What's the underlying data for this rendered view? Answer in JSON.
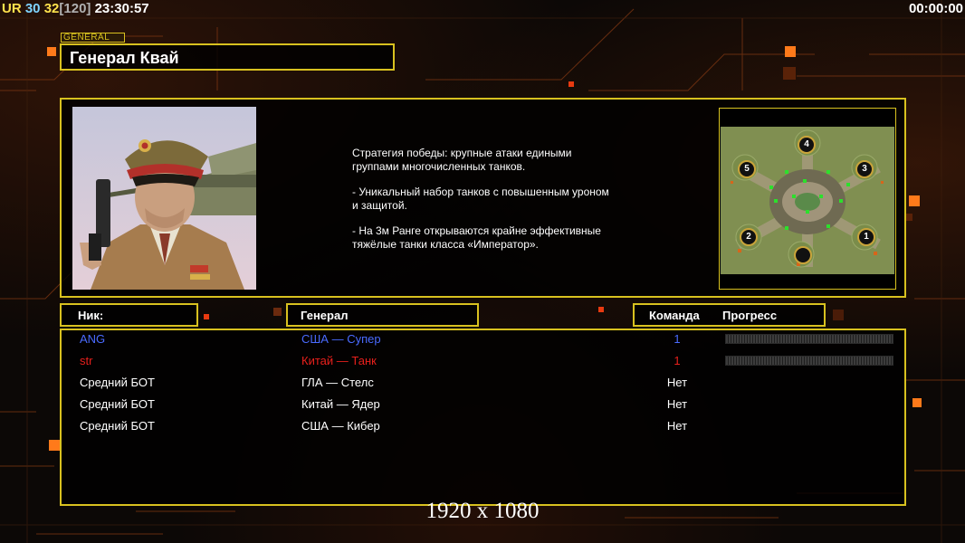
{
  "hud": {
    "ur_label": "UR",
    "fps_a": "30",
    "fps_b": "32",
    "fps_cap": "[120]",
    "clock": "23:30:57",
    "game_timer": "00:00:00"
  },
  "general_tag": "GENERAL",
  "general_name": "Генерал Квай",
  "description": [
    "Стратегия победы: крупные атаки едиными\n группами многочисленных танков.",
    "- Уникальный набор танков с повышенным уроном\n и защитой.",
    "- На 3м Ранге открываются крайне эффективные\n тяжёлые танки класса «Император»."
  ],
  "map": {
    "start_markers": [
      "4",
      "5",
      "3",
      "2",
      "1"
    ]
  },
  "columns": {
    "nick": "Ник:",
    "general": "Генерал",
    "team": "Команда",
    "progress": "Прогресс"
  },
  "players": [
    {
      "nick": "ANG",
      "general": "США — Супер",
      "team": "1",
      "color": "#4a6bff",
      "progress_bar": true
    },
    {
      "nick": "str",
      "general": "Китай — Танк",
      "team": "1",
      "color": "#e8201c",
      "progress_bar": true
    },
    {
      "nick": "Средний БОТ",
      "general": "ГЛА — Стелс",
      "team": "Нет",
      "color": "#ffffff",
      "progress_bar": false
    },
    {
      "nick": "Средний БОТ",
      "general": "Китай — Ядер",
      "team": "Нет",
      "color": "#ffffff",
      "progress_bar": false
    },
    {
      "nick": "Средний БОТ",
      "general": "США — Кибер",
      "team": "Нет",
      "color": "#ffffff",
      "progress_bar": false
    }
  ],
  "resolution_watermark": "1920 x 1080",
  "accent_color": "#d8c11f"
}
